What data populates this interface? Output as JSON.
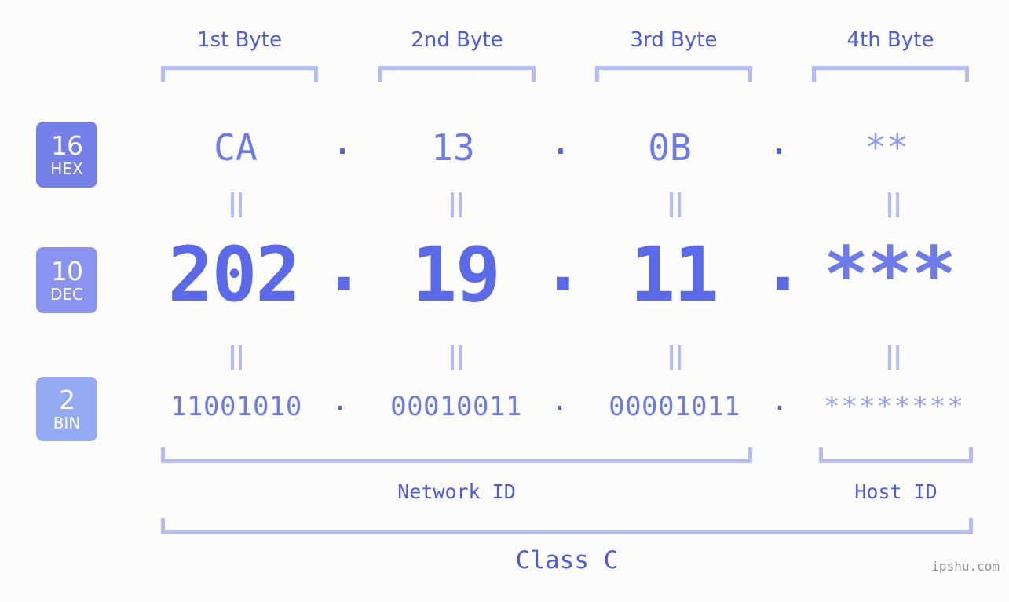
{
  "meta": {
    "background_color": "#fcfdfa",
    "accent_color": "#4a5bea",
    "bracket_color": "#b3bcf8",
    "watermark": "ipshu.com"
  },
  "byte_headers": [
    {
      "label": "1st Byte"
    },
    {
      "label": "2nd Byte"
    },
    {
      "label": "3rd Byte"
    },
    {
      "label": "4th Byte"
    }
  ],
  "bases": [
    {
      "id": "hex",
      "number": "16",
      "abbr": "HEX",
      "color": "#7480e8"
    },
    {
      "id": "dec",
      "number": "10",
      "abbr": "DEC",
      "color": "#8a93ef"
    },
    {
      "id": "bin",
      "number": "2",
      "abbr": "BIN",
      "color": "#94aaf2"
    }
  ],
  "rows": {
    "hex": {
      "base_label": "HEX",
      "values": [
        "CA",
        "13",
        "0B",
        "**"
      ],
      "separators": [
        ".",
        ".",
        "."
      ]
    },
    "dec": {
      "base_label": "DEC",
      "values": [
        "202",
        "19",
        "11",
        "***"
      ],
      "separators": [
        ".",
        ".",
        "."
      ]
    },
    "bin": {
      "base_label": "BIN",
      "values": [
        "11001010",
        "00010011",
        "00001011",
        "********"
      ],
      "separators": [
        ".",
        ".",
        "."
      ]
    }
  },
  "equals_symbol": "=",
  "footer": {
    "network_id_label": "Network ID",
    "host_id_label": "Host ID",
    "class_label": "Class C"
  }
}
